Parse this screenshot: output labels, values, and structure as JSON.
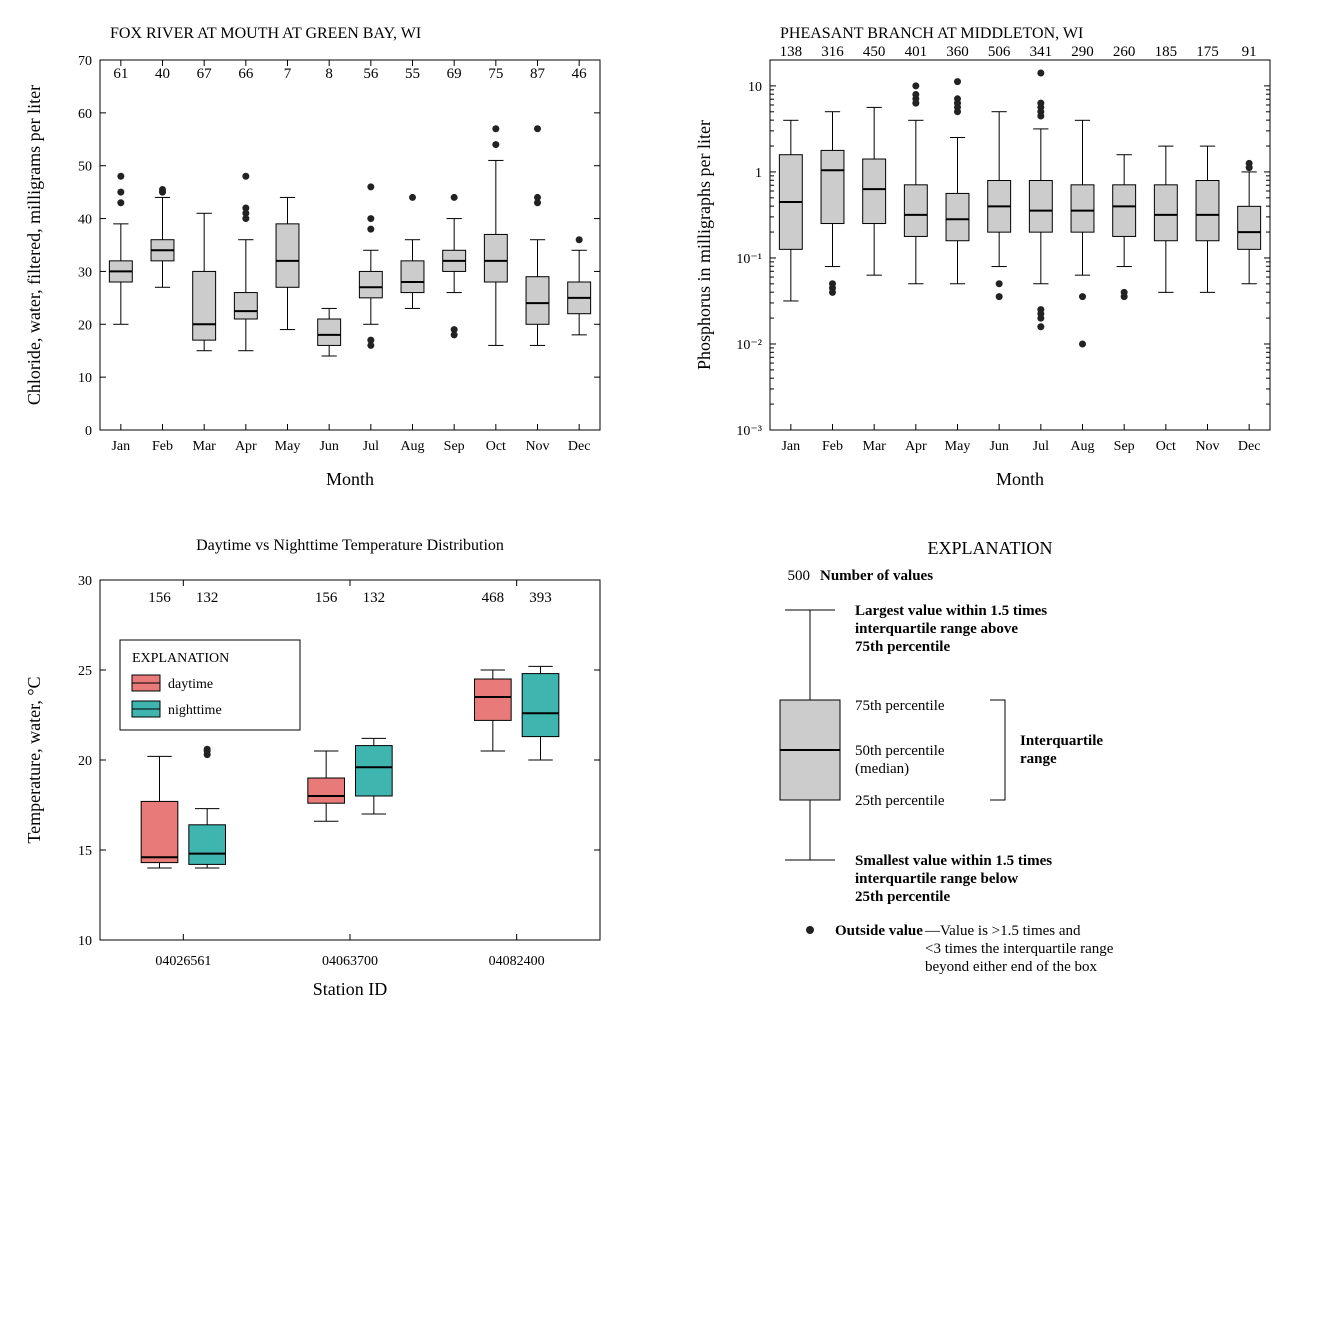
{
  "chart_data": [
    {
      "type": "boxplot",
      "title": "FOX RIVER AT MOUTH AT GREEN BAY, WI",
      "xlabel": "Month",
      "ylabel": "Chloride, water, filtered, milligrams per liter",
      "ylim": [
        0,
        70
      ],
      "yticks": [
        0,
        10,
        20,
        30,
        40,
        50,
        60,
        70
      ],
      "categories": [
        "Jan",
        "Feb",
        "Mar",
        "Apr",
        "May",
        "Jun",
        "Jul",
        "Aug",
        "Sep",
        "Oct",
        "Nov",
        "Dec"
      ],
      "counts": [
        61,
        40,
        67,
        66,
        7,
        8,
        56,
        55,
        69,
        75,
        87,
        46
      ],
      "boxes": [
        {
          "wlo": 20,
          "q1": 28,
          "med": 30,
          "q3": 32,
          "whi": 39,
          "out": [
            43,
            45,
            48
          ]
        },
        {
          "wlo": 27,
          "q1": 32,
          "med": 34,
          "q3": 36,
          "whi": 44,
          "out": [
            45,
            45.5
          ]
        },
        {
          "wlo": 15,
          "q1": 17,
          "med": 20,
          "q3": 30,
          "whi": 41,
          "out": []
        },
        {
          "wlo": 15,
          "q1": 21,
          "med": 22.5,
          "q3": 26,
          "whi": 36,
          "out": [
            40,
            41,
            42,
            48
          ]
        },
        {
          "wlo": 19,
          "q1": 27,
          "med": 32,
          "q3": 39,
          "whi": 44,
          "out": []
        },
        {
          "wlo": 14,
          "q1": 16,
          "med": 18,
          "q3": 21,
          "whi": 23,
          "out": []
        },
        {
          "wlo": 20,
          "q1": 25,
          "med": 27,
          "q3": 30,
          "whi": 34,
          "out": [
            16,
            17,
            38,
            40,
            46
          ]
        },
        {
          "wlo": 23,
          "q1": 26,
          "med": 28,
          "q3": 32,
          "whi": 36,
          "out": [
            44
          ]
        },
        {
          "wlo": 26,
          "q1": 30,
          "med": 32,
          "q3": 34,
          "whi": 40,
          "out": [
            18,
            19,
            44
          ]
        },
        {
          "wlo": 16,
          "q1": 28,
          "med": 32,
          "q3": 37,
          "whi": 51,
          "out": [
            54,
            57
          ]
        },
        {
          "wlo": 16,
          "q1": 20,
          "med": 24,
          "q3": 29,
          "whi": 36,
          "out": [
            43,
            44,
            57
          ]
        },
        {
          "wlo": 18,
          "q1": 22,
          "med": 25,
          "q3": 28,
          "whi": 34,
          "out": [
            36
          ]
        }
      ]
    },
    {
      "type": "boxplot",
      "title": "PHEASANT BRANCH AT MIDDLETON, WI",
      "xlabel": "Month",
      "ylabel": "Phosphorus in milligraphs per liter",
      "ylim_log": [
        -3,
        1.301
      ],
      "yticks_log": [
        -3,
        -2,
        -1,
        0,
        1
      ],
      "ytick_labels": [
        "10⁻³",
        "10⁻²",
        "10⁻¹",
        "1",
        "10"
      ],
      "categories": [
        "Jan",
        "Feb",
        "Mar",
        "Apr",
        "May",
        "Jun",
        "Jul",
        "Aug",
        "Sep",
        "Oct",
        "Nov",
        "Dec"
      ],
      "counts": [
        138,
        316,
        450,
        401,
        360,
        506,
        341,
        290,
        260,
        185,
        175,
        91
      ],
      "boxes_log": [
        {
          "wlo": -1.5,
          "q1": -0.9,
          "med": -0.35,
          "q3": 0.2,
          "whi": 0.6,
          "out": []
        },
        {
          "wlo": -1.1,
          "q1": -0.6,
          "med": 0.02,
          "q3": 0.25,
          "whi": 0.7,
          "out": [
            -1.3,
            -1.35,
            -1.4
          ]
        },
        {
          "wlo": -1.2,
          "q1": -0.6,
          "med": -0.2,
          "q3": 0.15,
          "whi": 0.75,
          "out": []
        },
        {
          "wlo": -1.3,
          "q1": -0.75,
          "med": -0.5,
          "q3": -0.15,
          "whi": 0.6,
          "out": [
            0.8,
            0.85,
            0.9,
            1.0
          ]
        },
        {
          "wlo": -1.3,
          "q1": -0.8,
          "med": -0.55,
          "q3": -0.25,
          "whi": 0.4,
          "out": [
            0.7,
            0.75,
            0.8,
            0.85,
            1.05
          ]
        },
        {
          "wlo": -1.1,
          "q1": -0.7,
          "med": -0.4,
          "q3": -0.1,
          "whi": 0.7,
          "out": [
            -1.3,
            -1.45
          ]
        },
        {
          "wlo": -1.3,
          "q1": -0.7,
          "med": -0.45,
          "q3": -0.1,
          "whi": 0.5,
          "out": [
            0.65,
            0.7,
            0.75,
            0.8,
            1.15,
            -1.6,
            -1.65,
            -1.7,
            -1.8
          ]
        },
        {
          "wlo": -1.2,
          "q1": -0.7,
          "med": -0.45,
          "q3": -0.15,
          "whi": 0.6,
          "out": [
            -1.45,
            -2.0
          ]
        },
        {
          "wlo": -1.1,
          "q1": -0.75,
          "med": -0.4,
          "q3": -0.15,
          "whi": 0.2,
          "out": [
            -1.4,
            -1.45
          ]
        },
        {
          "wlo": -1.4,
          "q1": -0.8,
          "med": -0.5,
          "q3": -0.15,
          "whi": 0.3,
          "out": []
        },
        {
          "wlo": -1.4,
          "q1": -0.8,
          "med": -0.5,
          "q3": -0.1,
          "whi": 0.3,
          "out": []
        },
        {
          "wlo": -1.3,
          "q1": -0.9,
          "med": -0.7,
          "q3": -0.4,
          "whi": 0.0,
          "out": [
            0.05,
            0.1
          ]
        }
      ]
    },
    {
      "type": "boxplot",
      "title": "Daytime vs Nighttime Temperature Distribution",
      "xlabel": "Station ID",
      "ylabel": "Temperature, water, °C",
      "ylim": [
        10,
        30
      ],
      "yticks": [
        10,
        15,
        20,
        25,
        30
      ],
      "categories": [
        "04026561",
        "04063700",
        "04082400"
      ],
      "series": [
        {
          "name": "daytime",
          "color": "#e87a7a",
          "counts": [
            156,
            156,
            468
          ],
          "boxes": [
            {
              "wlo": 14,
              "q1": 14.3,
              "med": 14.6,
              "q3": 17.7,
              "whi": 20.2,
              "out": []
            },
            {
              "wlo": 16.6,
              "q1": 17.6,
              "med": 18.0,
              "q3": 19.0,
              "whi": 20.5,
              "out": []
            },
            {
              "wlo": 20.5,
              "q1": 22.2,
              "med": 23.5,
              "q3": 24.5,
              "whi": 25.0,
              "out": []
            }
          ]
        },
        {
          "name": "nighttime",
          "color": "#3fb5b0",
          "counts": [
            132,
            132,
            393
          ],
          "boxes": [
            {
              "wlo": 14,
              "q1": 14.2,
              "med": 14.8,
              "q3": 16.4,
              "whi": 17.3,
              "out": [
                20.3,
                20.5,
                20.6
              ]
            },
            {
              "wlo": 17.0,
              "q1": 18.0,
              "med": 19.6,
              "q3": 20.8,
              "whi": 21.2,
              "out": []
            },
            {
              "wlo": 20.0,
              "q1": 21.3,
              "med": 22.6,
              "q3": 24.8,
              "whi": 25.2,
              "out": []
            }
          ]
        }
      ],
      "legend_title": "EXPLANATION"
    }
  ],
  "explanation": {
    "title": "EXPLANATION",
    "count_label": "500",
    "count_text": "Number of values",
    "upper_whisker": [
      "Largest value within 1.5 times",
      "interquartile range above",
      "75th percentile"
    ],
    "p75": "75th percentile",
    "median": [
      "50th percentile",
      "(median)"
    ],
    "p25": "25th percentile",
    "iqr": [
      "Interquartile",
      "range"
    ],
    "lower_whisker": [
      "Smallest value within 1.5 times",
      "interquartile range below",
      "25th percentile"
    ],
    "outside_label": "Outside value",
    "outside_text": [
      "—Value is >1.5 times and",
      "<3 times the interquartile range",
      "beyond either end of the box"
    ]
  }
}
